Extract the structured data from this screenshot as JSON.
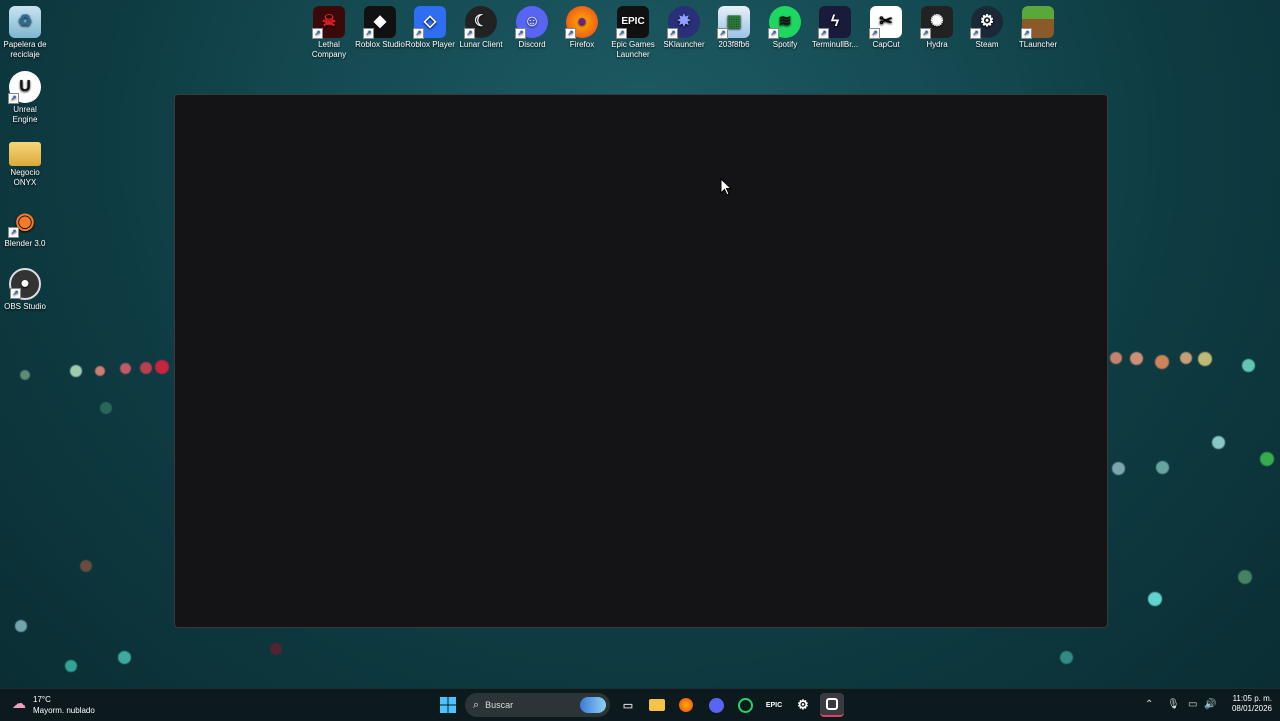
{
  "desktop": {
    "left_icons": [
      {
        "label": "Papelera de reciclaje",
        "icon": "recycle-bin-icon"
      },
      {
        "label": "Unreal Engine",
        "icon": "unreal-engine-icon"
      },
      {
        "label": "Negocio ONYX",
        "icon": "folder-icon"
      },
      {
        "label": "Blender 3.0",
        "icon": "blender-icon"
      },
      {
        "label": "OBS Studio",
        "icon": "obs-icon"
      }
    ],
    "top_icons": [
      {
        "label": "Lethal Company",
        "icon": "lethal-company-icon"
      },
      {
        "label": "Roblox Studio",
        "icon": "roblox-studio-icon"
      },
      {
        "label": "Roblox Player",
        "icon": "roblox-player-icon"
      },
      {
        "label": "Lunar Client",
        "icon": "lunar-client-icon"
      },
      {
        "label": "Discord",
        "icon": "discord-icon"
      },
      {
        "label": "Firefox",
        "icon": "firefox-icon"
      },
      {
        "label": "Epic Games Launcher",
        "icon": "epic-games-icon"
      },
      {
        "label": "SKlauncher",
        "icon": "sklauncher-icon"
      },
      {
        "label": "203f8fb6",
        "icon": "file-icon"
      },
      {
        "label": "Spotify",
        "icon": "spotify-icon"
      },
      {
        "label": "TerminullBr...",
        "icon": "terminull-icon"
      },
      {
        "label": "CapCut",
        "icon": "capcut-icon"
      },
      {
        "label": "Hydra",
        "icon": "hydra-icon"
      },
      {
        "label": "Steam",
        "icon": "steam-icon"
      },
      {
        "label": "TLauncher",
        "icon": "tlauncher-icon"
      }
    ]
  },
  "taskbar": {
    "weather": {
      "temp": "17°C",
      "condition": "Mayorm. nublado"
    },
    "search_placeholder": "Buscar",
    "clock": {
      "time": "11:05 p. m.",
      "date": "08/01/2026"
    }
  }
}
